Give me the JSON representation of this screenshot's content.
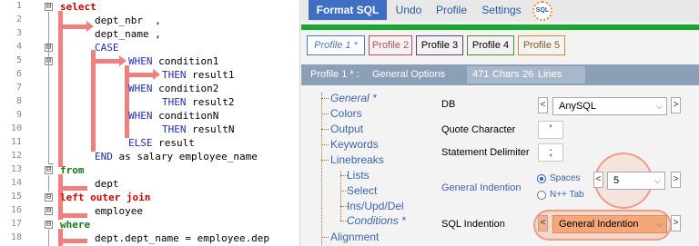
{
  "editor": {
    "line_numbers": [
      "1",
      "2",
      "3",
      "4",
      "5",
      "6",
      "7",
      "8",
      "9",
      "10",
      "11",
      "12",
      "13",
      "14",
      "15",
      "16",
      "17",
      "18"
    ],
    "fold_markers": [
      "⊟",
      "⊟",
      "⊟",
      "⊟",
      "⊟",
      "⊟",
      "⊟"
    ],
    "lines": {
      "l1": "select",
      "l2": "dept_nbr  ,",
      "l3": "dept_name ,",
      "l4": "CASE",
      "l5a": "WHEN",
      "l5b": " condition1",
      "l6a": "THEN",
      "l6b": " result1",
      "l7a": "WHEN",
      "l7b": " condition2",
      "l8a": "THEN",
      "l8b": " result2",
      "l9a": "WHEN",
      "l9b": " conditionN",
      "l10a": "THEN",
      "l10b": " resultN",
      "l11a": "ELSE",
      "l11b": " result",
      "l12a": "END",
      "l12b": " as salary employee_name",
      "l13": "from",
      "l14": "dept",
      "l15": "left outer join",
      "l16": "employee",
      "l17": "where",
      "l18": "dept.dept_name = employee.dep"
    }
  },
  "toolbar": {
    "format_label": "Format SQL",
    "undo_label": "Undo",
    "profile_label": "Profile",
    "settings_label": "Settings",
    "logo_text": "SQL"
  },
  "profile_tabs": [
    {
      "label": "Profile 1 *",
      "color": "#4b78c4"
    },
    {
      "label": "Profile 2",
      "color": "#c0504d"
    },
    {
      "label": "Profile 3",
      "color": "#7030a0"
    },
    {
      "label": "Profile 4",
      "color": "#4e8a2e"
    },
    {
      "label": "Profile 5",
      "color": "#e0892a"
    }
  ],
  "infobar": {
    "profile": "Profile 1 * :",
    "section": "General Options",
    "chars_count": "471",
    "chars_label": "Chars",
    "lines_count": "26",
    "lines_label": "Lines"
  },
  "tree": {
    "items": [
      {
        "label": "General *"
      },
      {
        "label": "Colors"
      },
      {
        "label": "Output"
      },
      {
        "label": "Keywords"
      },
      {
        "label": "Linebreaks"
      },
      {
        "label": "Lists"
      },
      {
        "label": "Select"
      },
      {
        "label": "Ins/Upd/Del"
      },
      {
        "label": "Conditions *"
      },
      {
        "label": "Alignment"
      }
    ]
  },
  "options": {
    "db_label": "DB",
    "db_value": "AnySQL",
    "quote_label": "Quote Character",
    "quote_value": "'",
    "delim_label": "Statement Delimiter",
    "delim_value": ";",
    "gen_indent_label": "General Indention",
    "spaces_label": "Spaces",
    "ntab_label": "N++ Tab",
    "indent_value": "5",
    "sql_indent_label": "SQL Indention",
    "sql_indent_value": "General Indention",
    "prev_symbol": "<",
    "next_symbol": ">",
    "dropdown_symbol": "⌵"
  },
  "colors": {
    "accent_blue": "#3f6fc3",
    "green_bar": "#18a830",
    "highlight_pink": "#f08080",
    "info_bar": "#8b9fb8",
    "highlight_orange": "#f6a77a"
  }
}
